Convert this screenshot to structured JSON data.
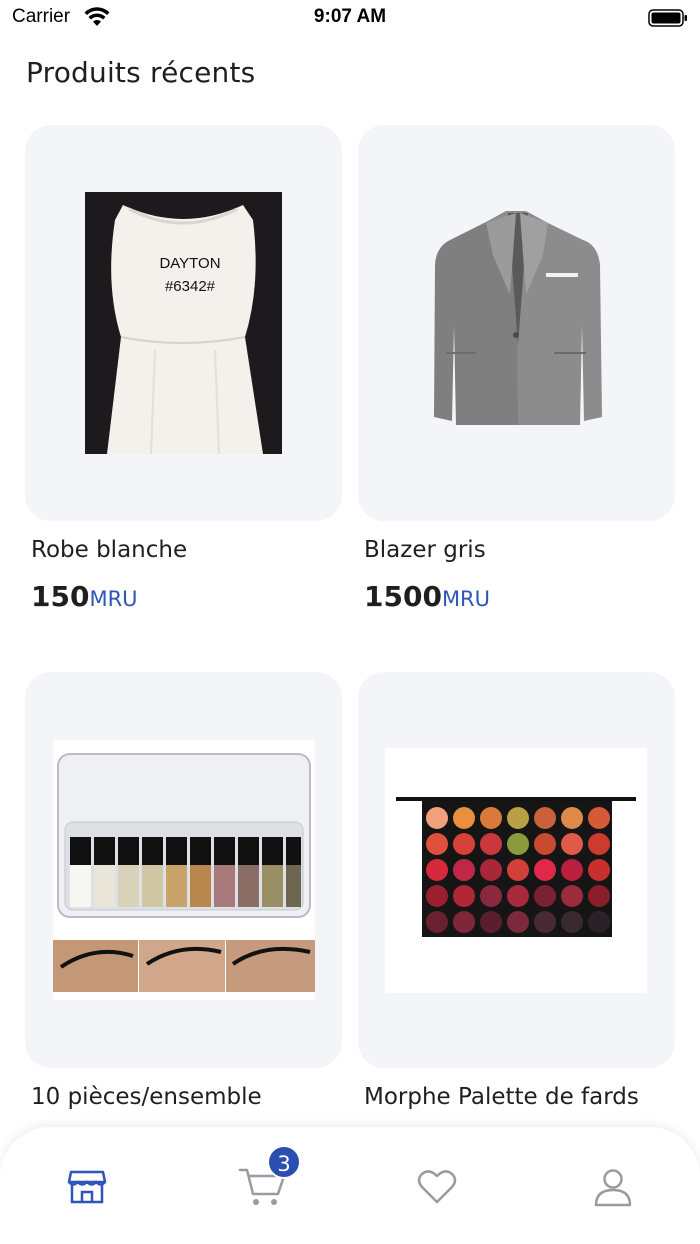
{
  "status_bar": {
    "carrier": "Carrier",
    "time": "9:07 AM"
  },
  "page": {
    "title": "Produits récents"
  },
  "products": [
    {
      "name": "Robe blanche",
      "price": "150",
      "currency": "MRU",
      "image_text_1": "DAYTON",
      "image_text_2": "#6342#"
    },
    {
      "name": "Blazer gris",
      "price": "1500",
      "currency": "MRU"
    },
    {
      "name": "10 pièces/ensemble",
      "price": "",
      "currency": ""
    },
    {
      "name": "Morphe Palette de fards",
      "price": "",
      "currency": ""
    }
  ],
  "nav": {
    "items": [
      {
        "icon": "store-icon",
        "active": true
      },
      {
        "icon": "cart-icon",
        "active": false
      },
      {
        "icon": "heart-icon",
        "active": false
      },
      {
        "icon": "user-icon",
        "active": false
      }
    ],
    "cart_badge": "3"
  },
  "colors": {
    "accent": "#2f55b8",
    "card_bg": "#f4f5f9",
    "icon_inactive": "#9a9aa0",
    "badge": "#2a4fb0"
  }
}
